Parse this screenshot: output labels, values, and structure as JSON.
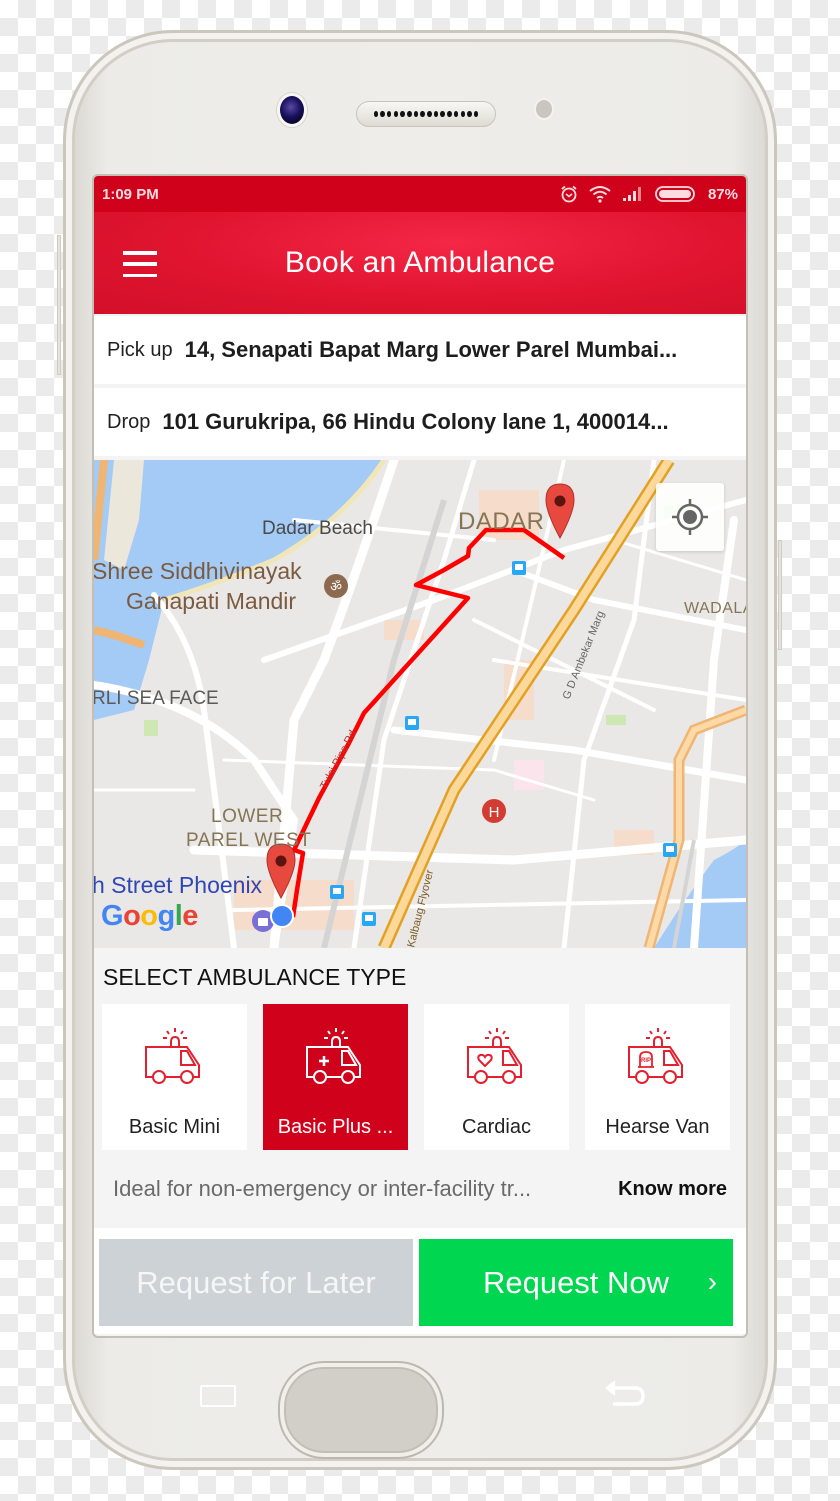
{
  "status_bar": {
    "time": "1:09 PM",
    "battery_percent": "87%",
    "icons": [
      "alarm-icon",
      "wifi-icon",
      "signal-icon",
      "battery-icon"
    ]
  },
  "app_bar": {
    "title": "Book an Ambulance",
    "menu_icon": "hamburger-menu-icon"
  },
  "pickup": {
    "label": "Pick up",
    "value": "14, Senapati Bapat Marg Lower Parel Mumbai..."
  },
  "drop": {
    "label": "Drop",
    "value": "101 Gurukripa, 66 Hindu Colony lane 1, 400014..."
  },
  "map": {
    "labels": {
      "dadar_beach": "Dadar Beach",
      "siddhivinayak_1": "Shree Siddhivinayak",
      "siddhivinayak_2": "Ganapati Mandir",
      "dadar": "DADAR",
      "wadala": "WADALA",
      "worli_sea_face": "RLI SEA FACE",
      "lower_parel_1": "LOWER",
      "lower_parel_2": "PAREL WEST",
      "phoenix": "h Street Phoenix",
      "ambekar_marg": "G D Ambekar Marg",
      "tulsi_pipe_rd": "Tulsi Pipe Rd",
      "kalbaug_flyover": "Kalbaug Flyover",
      "hospital_marker": "H",
      "google_logo": "Google"
    },
    "locate_button_icon": "my-location-icon",
    "route_color": "#ff0000",
    "marker_color": "#e8493f"
  },
  "ambulance_section": {
    "title": "SELECT AMBULANCE TYPE",
    "types": [
      {
        "name": "Basic Mini",
        "icon": "ambulance-van-icon",
        "selected": false
      },
      {
        "name": "Basic Plus ...",
        "icon": "ambulance-plus-icon",
        "selected": true
      },
      {
        "name": "Cardiac",
        "icon": "ambulance-heart-icon",
        "selected": false
      },
      {
        "name": "Hearse Van",
        "icon": "hearse-van-icon",
        "selected": false
      }
    ],
    "description": "Ideal for non-emergency or inter-facility tr...",
    "know_more": "Know more"
  },
  "actions": {
    "request_later": "Request for Later",
    "request_now": "Request Now",
    "request_now_chevron": "›"
  },
  "colors": {
    "brand_red": "#d0021b",
    "request_now_green": "#00d650",
    "request_later_gray": "#cdd2d6"
  }
}
